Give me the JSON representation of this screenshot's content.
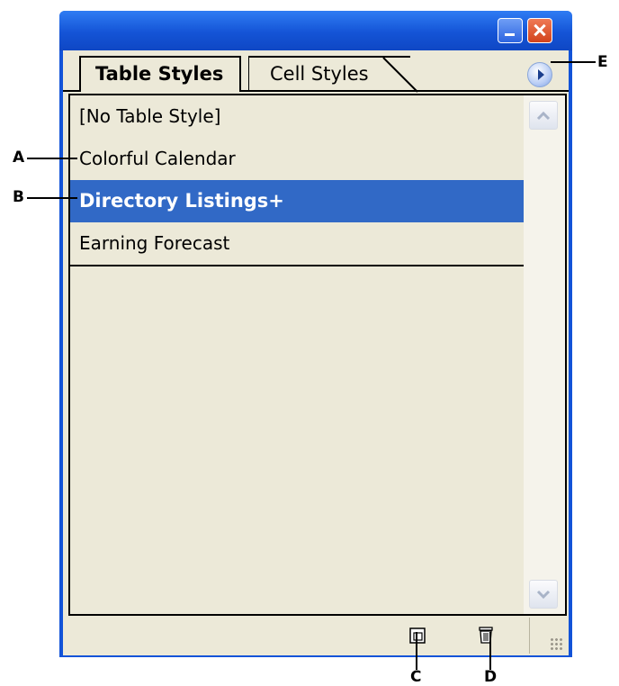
{
  "tabs": [
    {
      "label": "Table Styles",
      "active": true
    },
    {
      "label": "Cell Styles",
      "active": false
    }
  ],
  "styles_list": [
    {
      "label": "[No Table Style]",
      "selected": false
    },
    {
      "label": "Colorful Calendar",
      "selected": false
    },
    {
      "label": "Directory Listings+",
      "selected": true
    },
    {
      "label": "Earning Forecast",
      "selected": false
    }
  ],
  "callouts": {
    "a": "A",
    "b": "B",
    "c": "C",
    "d": "D",
    "e": "E"
  },
  "icons": {
    "minimize": "minimize-icon",
    "close": "close-icon",
    "panel_menu": "panel-menu-icon",
    "new_style": "new-style-icon",
    "delete_style": "trash-icon",
    "scroll_up": "chevron-up-icon",
    "scroll_down": "chevron-down-icon",
    "resize": "resize-grip-icon"
  },
  "colors": {
    "titlebar": "#1253d8",
    "panel": "#ece9d8",
    "selection": "#3169c6"
  }
}
